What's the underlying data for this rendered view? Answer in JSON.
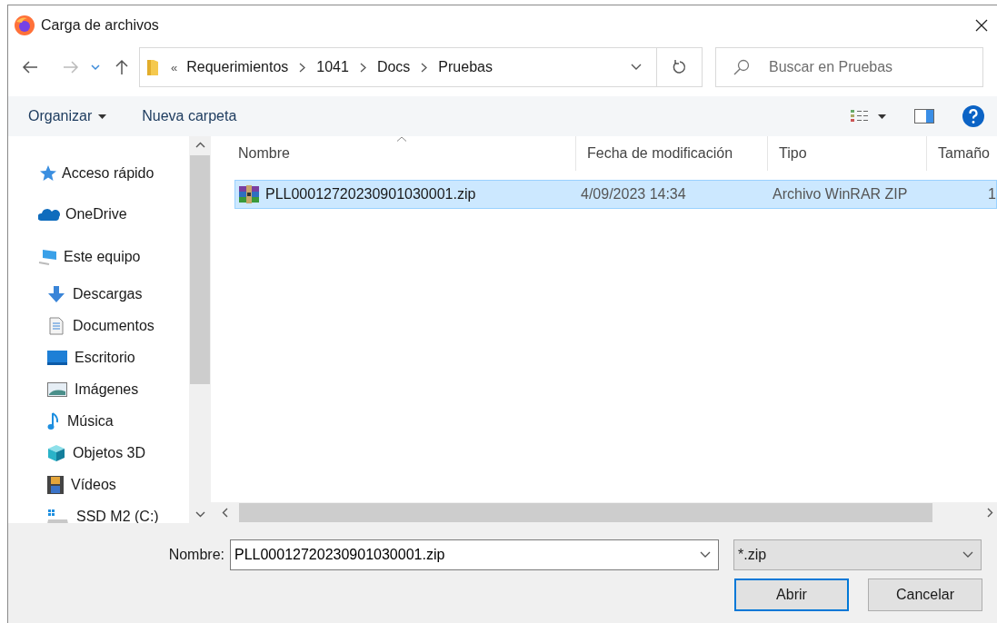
{
  "window": {
    "title": "Carga de archivos"
  },
  "address": {
    "overflow_marker": "«",
    "path": [
      "Requerimientos",
      "1041",
      "Docs",
      "Pruebas"
    ]
  },
  "search": {
    "placeholder": "Buscar en Pruebas"
  },
  "toolbar": {
    "items": [
      {
        "label": "Organizar",
        "kind": "menu"
      },
      {
        "label": "Nueva carpeta",
        "kind": "button"
      }
    ]
  },
  "sidebar": {
    "items": [
      {
        "label": "Acceso rápido"
      },
      {
        "label": "OneDrive"
      },
      {
        "label": "Este equipo",
        "children": [
          {
            "label": "Descargas"
          },
          {
            "label": "Documentos"
          },
          {
            "label": "Escritorio"
          },
          {
            "label": "Imágenes"
          },
          {
            "label": "Música"
          },
          {
            "label": "Objetos 3D"
          },
          {
            "label": "Vídeos"
          },
          {
            "label": "SSD M2 (C:)"
          }
        ]
      }
    ]
  },
  "file_list": {
    "columns": [
      {
        "label": "Nombre",
        "sorted": true
      },
      {
        "label": "Fecha de modificación",
        "sorted": false
      },
      {
        "label": "Tipo",
        "sorted": false
      },
      {
        "label": "Tamaño",
        "sorted": false
      }
    ],
    "rows": [
      {
        "name": "PLL00012720230901030001.zip",
        "date": "4/09/2023 14:34",
        "type": "Archivo WinRAR ZIP",
        "size": "1",
        "selected": true
      }
    ]
  },
  "footer": {
    "name_label": "Nombre:",
    "name_value": "PLL00012720230901030001.zip",
    "filter": "*.zip",
    "buttons": [
      {
        "label": "Abrir",
        "default": true
      },
      {
        "label": "Cancelar",
        "default": false
      }
    ]
  }
}
